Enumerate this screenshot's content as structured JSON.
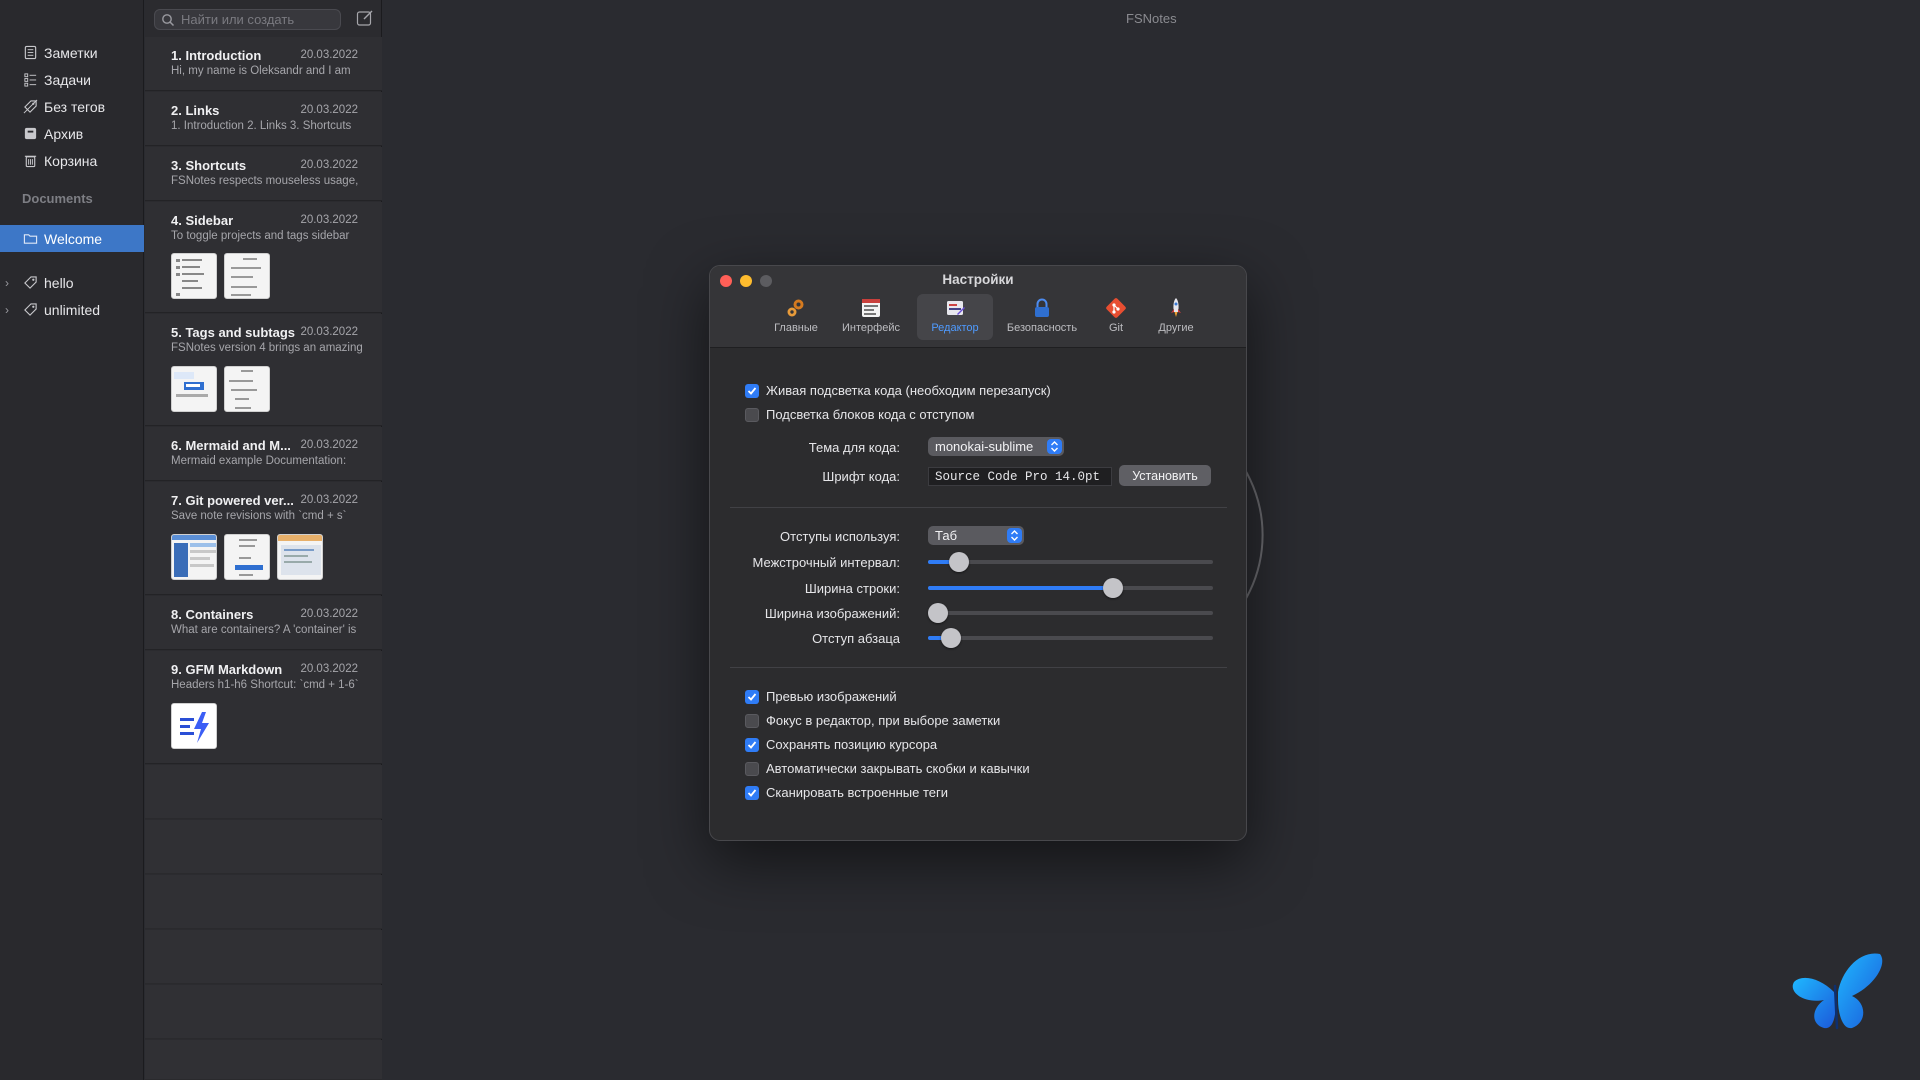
{
  "app": {
    "title": "FSNotes"
  },
  "sidebar": {
    "items": [
      {
        "label": "Заметки",
        "icon": "notes-icon"
      },
      {
        "label": "Задачи",
        "icon": "tasks-icon"
      },
      {
        "label": "Без тегов",
        "icon": "untagged-icon"
      },
      {
        "label": "Архив",
        "icon": "archive-icon"
      },
      {
        "label": "Корзина",
        "icon": "trash-icon"
      }
    ],
    "section": "Documents",
    "folder": {
      "label": "Welcome",
      "icon": "folder-icon"
    },
    "tags": [
      {
        "label": "hello",
        "icon": "tag-icon"
      },
      {
        "label": "unlimited",
        "icon": "tag-icon"
      }
    ]
  },
  "search": {
    "placeholder": "Найти или создать"
  },
  "notes": [
    {
      "title": "1. Introduction",
      "date": "20.03.2022",
      "preview": "Hi, my name is Oleksandr and I am"
    },
    {
      "title": "2. Links",
      "date": "20.03.2022",
      "preview": "1. Introduction 2. Links 3. Shortcuts"
    },
    {
      "title": "3. Shortcuts",
      "date": "20.03.2022",
      "preview": "FSNotes respects mouseless usage,"
    },
    {
      "title": "4. Sidebar",
      "date": "20.03.2022",
      "preview": "To toggle projects and tags sidebar"
    },
    {
      "title": "5. Tags and subtags",
      "date": "20.03.2022",
      "preview": "FSNotes version 4 brings an amazing"
    },
    {
      "title": "6. Mermaid and M...",
      "date": "20.03.2022",
      "preview": "Mermaid example Documentation:"
    },
    {
      "title": "7. Git powered ver...",
      "date": "20.03.2022",
      "preview": "Save note revisions with `cmd + s`"
    },
    {
      "title": "8. Containers",
      "date": "20.03.2022",
      "preview": "What are containers? A 'container' is"
    },
    {
      "title": "9. GFM Markdown",
      "date": "20.03.2022",
      "preview": "Headers h1-h6 Shortcut: `cmd + 1-6`"
    }
  ],
  "prefs": {
    "window_title": "Настройки",
    "tabs": [
      {
        "label": "Главные",
        "icon": "gears-icon"
      },
      {
        "label": "Интерфейс",
        "icon": "interface-icon"
      },
      {
        "label": "Редактор",
        "icon": "editor-icon",
        "active": true
      },
      {
        "label": "Безопасность",
        "icon": "lock-icon"
      },
      {
        "label": "Git",
        "icon": "git-icon"
      },
      {
        "label": "Другие",
        "icon": "rocket-icon"
      }
    ],
    "live_highlight": {
      "label": "Живая подсветка кода (необходим перезапуск)",
      "checked": true
    },
    "indent_blocks": {
      "label": "Подсветка блоков кода с отступом",
      "checked": false
    },
    "code_theme": {
      "label": "Тема для кода:",
      "value": "monokai-sublime"
    },
    "code_font": {
      "label": "Шрифт кода:",
      "value": "Source Code Pro 14.0pt",
      "button": "Установить"
    },
    "indent_using": {
      "label": "Отступы используя:",
      "value": "Таб"
    },
    "sliders": [
      {
        "label": "Межстрочный интервал:",
        "value": 0.11
      },
      {
        "label": "Ширина строки:",
        "value": 0.65
      },
      {
        "label": "Ширина изображений:",
        "value": 0.0
      },
      {
        "label": "Отступ абзаца",
        "value": 0.08
      }
    ],
    "options": [
      {
        "label": "Превью изображений",
        "checked": true
      },
      {
        "label": "Фокус в редактор, при выборе заметки",
        "checked": false
      },
      {
        "label": "Сохранять позицию курсора",
        "checked": true
      },
      {
        "label": "Автоматически закрывать скобки и кавычки",
        "checked": false
      },
      {
        "label": "Сканировать встроенные теги",
        "checked": true
      }
    ]
  },
  "colors": {
    "accent": "#2f7cf6",
    "selection": "#3d77c7",
    "close": "#ff5f57",
    "minimize": "#febc2e",
    "zoom": "#5c5c60"
  }
}
